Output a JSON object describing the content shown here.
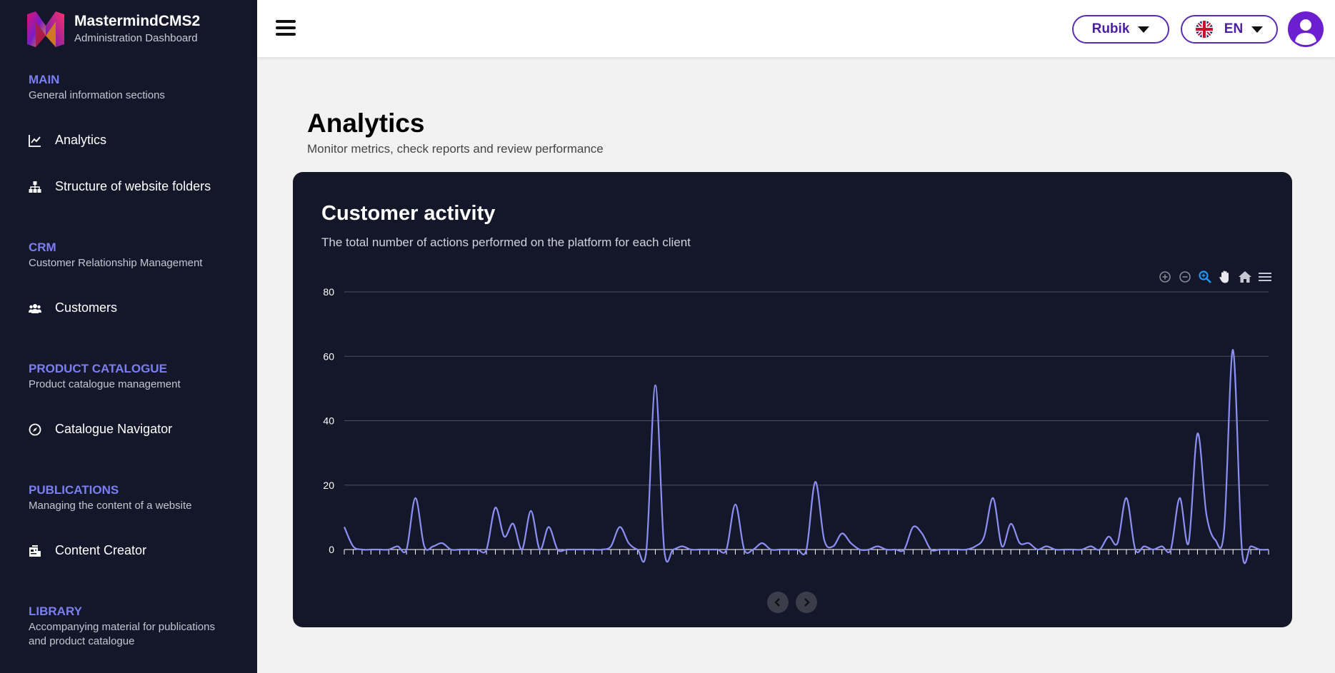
{
  "brand": {
    "name": "MastermindCMS2",
    "subtitle": "Administration Dashboard"
  },
  "sidebar": {
    "sections": [
      {
        "title": "MAIN",
        "description": "General information sections"
      },
      {
        "title": "CRM",
        "description": "Customer Relationship Management"
      },
      {
        "title": "PRODUCT CATALOGUE",
        "description": "Product catalogue management"
      },
      {
        "title": "PUBLICATIONS",
        "description": "Managing the content of a website"
      },
      {
        "title": "LIBRARY",
        "description": "Accompanying material for publications and product catalogue"
      }
    ],
    "items": [
      {
        "label": "Analytics",
        "icon": "line-chart-icon"
      },
      {
        "label": "Structure of website folders",
        "icon": "sitemap-icon"
      },
      {
        "label": "Customers",
        "icon": "users-icon"
      },
      {
        "label": "Catalogue Navigator",
        "icon": "compass-icon"
      },
      {
        "label": "Content Creator",
        "icon": "content-icon"
      }
    ]
  },
  "header": {
    "workspace": "Rubik",
    "language": "EN"
  },
  "page": {
    "title": "Analytics",
    "subtitle": "Monitor metrics, check reports and review performance"
  },
  "card": {
    "title": "Customer activity",
    "subtitle": "The total number of actions performed on the platform for each client"
  },
  "colors": {
    "accent": "#7b7ff0",
    "line": "#8c8ff5",
    "sidebar_bg": "#141729",
    "brand_purple": "#6c1fd0"
  },
  "chart_data": {
    "type": "line",
    "ylim": [
      0,
      80
    ],
    "yticks": [
      0,
      20,
      40,
      60,
      80
    ],
    "grid": true,
    "series": [
      {
        "values": [
          7,
          1,
          0,
          0,
          0,
          0,
          1,
          0,
          16,
          1,
          1,
          2,
          0,
          0,
          0,
          0,
          0,
          13,
          4,
          8,
          0,
          12,
          0,
          7,
          0,
          0,
          0,
          0,
          0,
          0,
          1,
          7,
          2,
          0,
          0,
          51,
          0,
          0,
          1,
          0,
          0,
          0,
          0,
          0,
          14,
          0,
          0,
          2,
          0,
          0,
          0,
          0,
          0,
          21,
          3,
          1,
          5,
          2,
          0,
          0,
          1,
          0,
          0,
          0,
          7,
          5,
          0,
          0,
          0,
          0,
          0,
          1,
          4,
          16,
          1,
          8,
          2,
          2,
          0,
          1,
          0,
          0,
          0,
          0,
          1,
          0,
          4,
          2,
          16,
          0,
          1,
          0,
          1,
          0,
          16,
          2,
          36,
          11,
          3,
          6,
          62,
          0,
          1,
          0,
          0
        ]
      }
    ]
  }
}
